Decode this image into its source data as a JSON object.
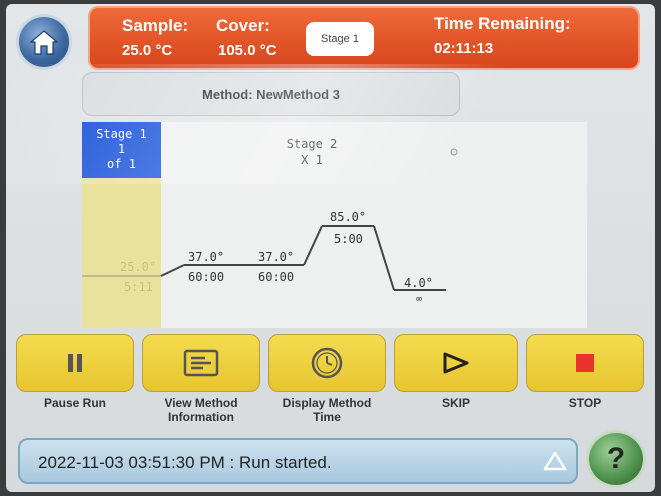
{
  "header": {
    "sample_label": "Sample:",
    "sample_value": "25.0 °C",
    "cover_label": "Cover:",
    "cover_value": "105.0 °C",
    "stage_button": "Stage 1",
    "time_label": "Time Remaining:",
    "time_value": "02:11:13"
  },
  "method": {
    "text": "Method: NewMethod 3"
  },
  "graph": {
    "stage1": {
      "line1": "Stage 1",
      "line2": "1",
      "line3": "of 1"
    },
    "stage2": {
      "line1": "Stage 2",
      "line2": "X 1"
    },
    "steps": [
      {
        "temp": "25.0°",
        "time": "5:11"
      },
      {
        "temp": "37.0°",
        "time": "60:00"
      },
      {
        "temp": "37.0°",
        "time": "60:00"
      },
      {
        "temp": "85.0°",
        "time": "5:00"
      },
      {
        "temp": "4.0°",
        "time": "∞"
      }
    ]
  },
  "buttons": {
    "pause": "Pause Run",
    "view_method_1": "View Method",
    "view_method_2": "Information",
    "display_time_1": "Display Method",
    "display_time_2": "Time",
    "skip": "SKIP",
    "stop": "STOP"
  },
  "status": {
    "message": "2022-11-03 03:51:30 PM : Run started."
  },
  "help": {
    "label": "?"
  },
  "colors": {
    "header": "#d8451c",
    "button": "#e7c52f",
    "stage_active": "#1550d8",
    "stop_icon": "#e8322a"
  }
}
